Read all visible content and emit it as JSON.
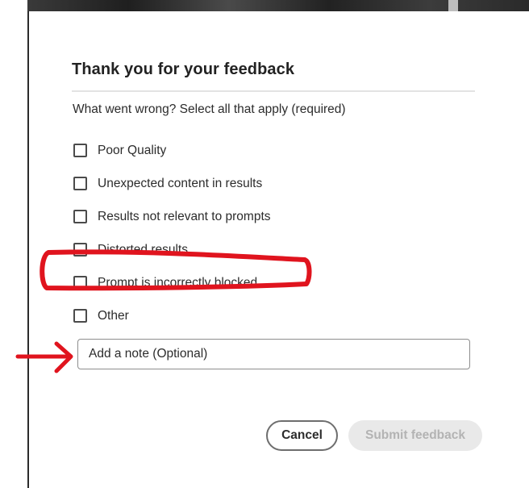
{
  "dialog": {
    "title": "Thank you for your feedback",
    "question": "What went wrong? Select all that apply (required)",
    "options": [
      {
        "label": "Poor Quality",
        "checked": false
      },
      {
        "label": "Unexpected content in results",
        "checked": false
      },
      {
        "label": "Results not relevant to prompts",
        "checked": false
      },
      {
        "label": "Distorted results",
        "checked": false
      },
      {
        "label": "Prompt is incorrectly blocked",
        "checked": false
      },
      {
        "label": "Other",
        "checked": false
      }
    ],
    "note": {
      "placeholder": "Add a note (Optional)",
      "value": ""
    },
    "buttons": {
      "cancel": "Cancel",
      "submit": "Submit feedback",
      "submit_enabled": false
    }
  },
  "annotations": {
    "color": "#e0141e",
    "highlighted_option": "Prompt is incorrectly blocked",
    "arrow_target": "note-input"
  },
  "colors": {
    "text": "#2c2c2c",
    "disabled_button_bg": "#e9e9e9",
    "disabled_button_text": "#b3b3b3"
  }
}
